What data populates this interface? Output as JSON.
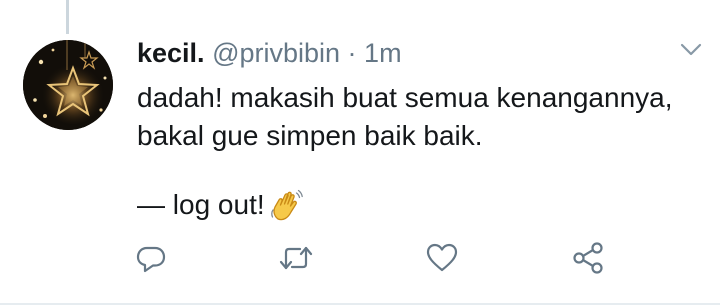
{
  "tweet": {
    "display_name": "kecil.",
    "handle": "@privbibin",
    "separator": " · ",
    "time": "1m",
    "lines": [
      "dadah! makasih buat semua kenangannya,",
      "bakal gue simpen baik baik."
    ],
    "signoff": "— log out!",
    "signoff_emoji": "waving-hand"
  },
  "actions": [
    {
      "name": "reply",
      "icon": "reply-icon"
    },
    {
      "name": "retweet",
      "icon": "retweet-icon"
    },
    {
      "name": "like",
      "icon": "heart-icon"
    },
    {
      "name": "share",
      "icon": "share-icon"
    }
  ],
  "colors": {
    "text_primary": "#14171a",
    "text_secondary": "#657786",
    "icon": "#657786",
    "thread_line": "#ccd6dd",
    "divider": "#e6ecf0"
  }
}
